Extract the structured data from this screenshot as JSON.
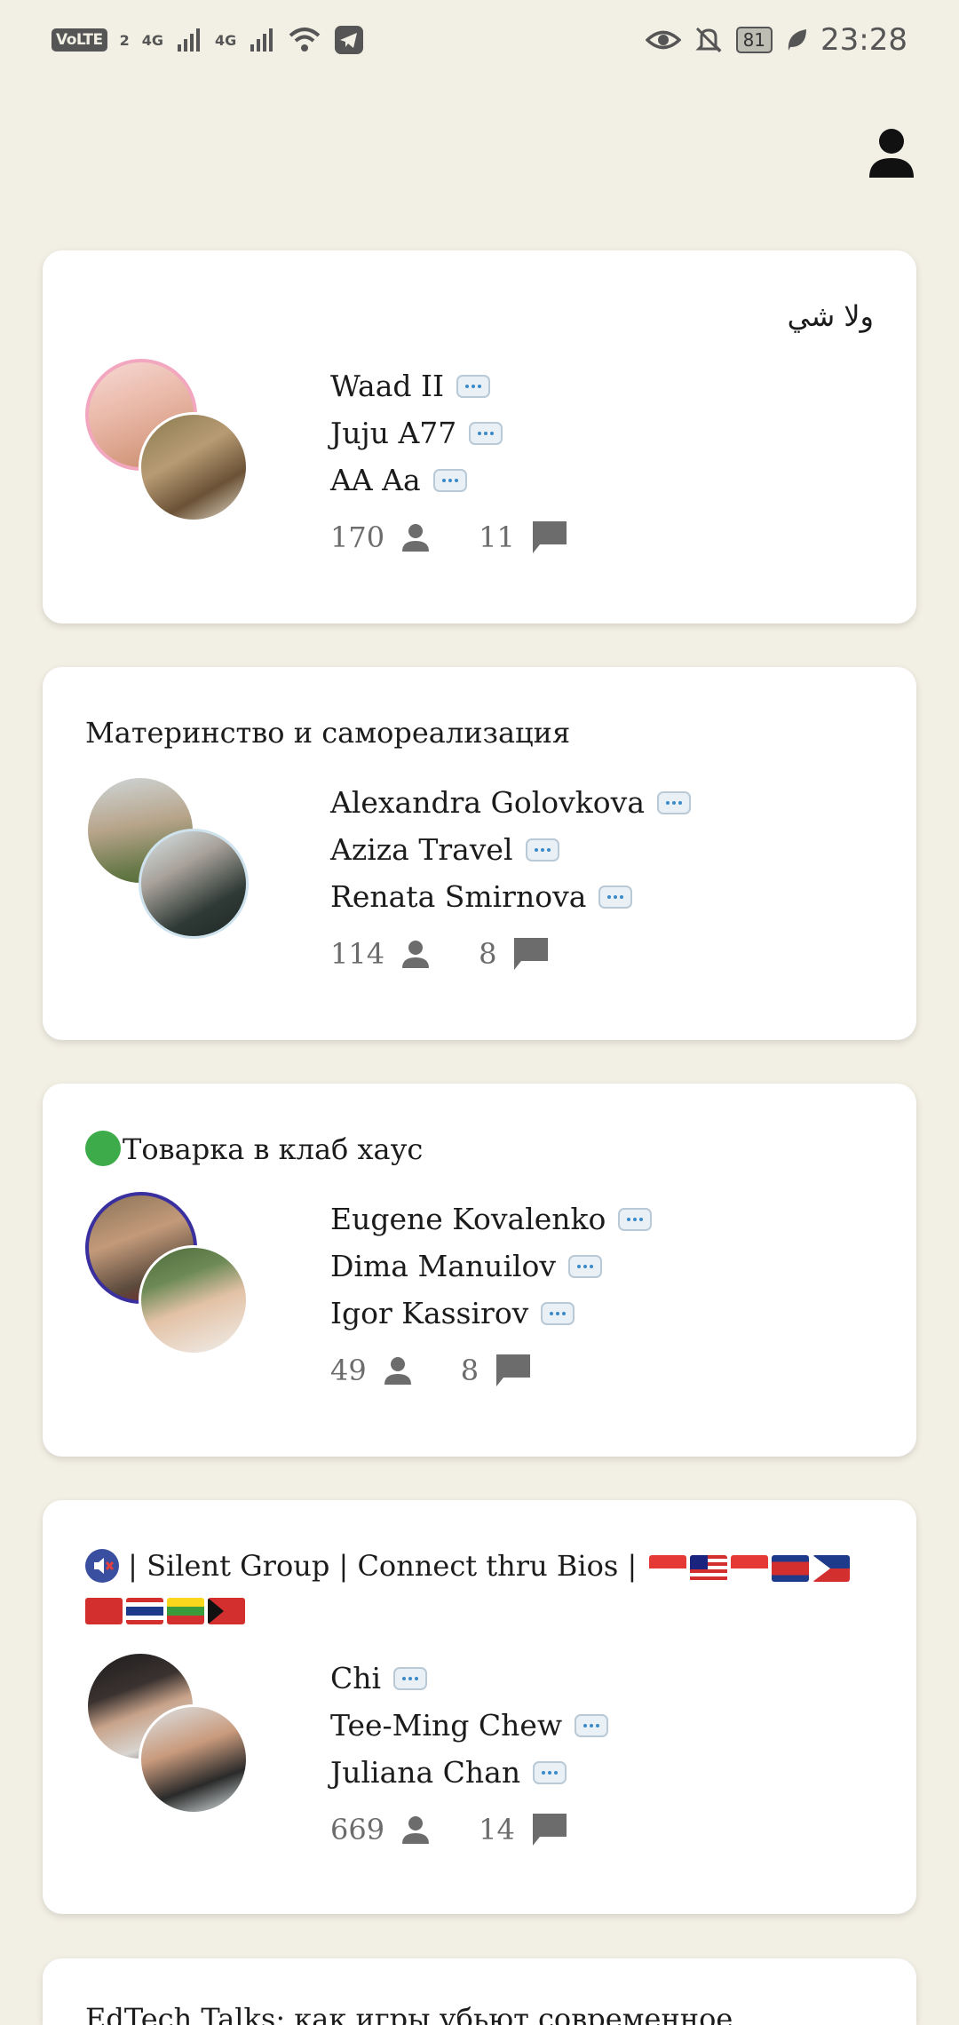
{
  "status_bar": {
    "volte": "VoLTE",
    "sim2": "2",
    "net1": "4G",
    "net2": "4G",
    "battery": "81",
    "time": "23:28"
  },
  "header": {
    "profile_icon": "person-icon"
  },
  "rooms": [
    {
      "title": "ولا شي",
      "speakers": [
        "Waad II",
        "Juju A77",
        "AA Aa"
      ],
      "listeners": "170",
      "speaker_count": "11"
    },
    {
      "title": "Материнство и самореализация",
      "speakers": [
        "Alexandra Golovkova",
        "Aziza Travel",
        "Renata Smirnova"
      ],
      "listeners": "114",
      "speaker_count": "8"
    },
    {
      "title": "Товарка в клаб хаус",
      "speakers": [
        "Eugene Kovalenko",
        "Dima Manuilov",
        "Igor Kassirov"
      ],
      "listeners": "49",
      "speaker_count": "8"
    },
    {
      "title": "| Silent Group | Connect thru Bios |",
      "speakers": [
        "Chi",
        "Tee-Ming Chew",
        "Juliana Chan"
      ],
      "listeners": "669",
      "speaker_count": "14"
    },
    {
      "title": "EdTech Talks: как игры убьют современное"
    }
  ],
  "colors": {
    "background": "#f2efe4",
    "card": "#ffffff",
    "muted_text": "#6c6c6c",
    "accent_green": "#3dab4a"
  }
}
